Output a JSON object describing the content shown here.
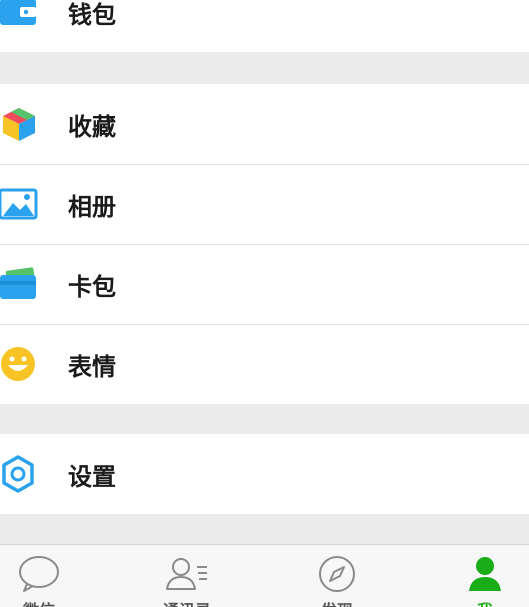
{
  "menu": {
    "group1": [
      {
        "label": "钱包",
        "icon": "wallet-icon"
      }
    ],
    "group2": [
      {
        "label": "收藏",
        "icon": "favorites-cube-icon"
      },
      {
        "label": "相册",
        "icon": "album-picture-icon"
      },
      {
        "label": "卡包",
        "icon": "card-wallet-icon"
      },
      {
        "label": "表情",
        "icon": "smiley-face-icon"
      }
    ],
    "group3": [
      {
        "label": "设置",
        "icon": "settings-gear-icon"
      }
    ]
  },
  "tabbar": {
    "tabs": [
      {
        "label": "微信",
        "icon": "chat-bubble-icon"
      },
      {
        "label": "通讯录",
        "icon": "contacts-icon"
      },
      {
        "label": "发现",
        "icon": "compass-icon"
      },
      {
        "label": "我",
        "icon": "person-icon"
      }
    ],
    "active_color": "#1aad19",
    "inactive_color": "#7a7a7a"
  },
  "colors": {
    "background": "#ebebeb",
    "row_background": "#ffffff",
    "icon_blue": "#2aa2ee",
    "icon_yellow": "#f7c325"
  }
}
